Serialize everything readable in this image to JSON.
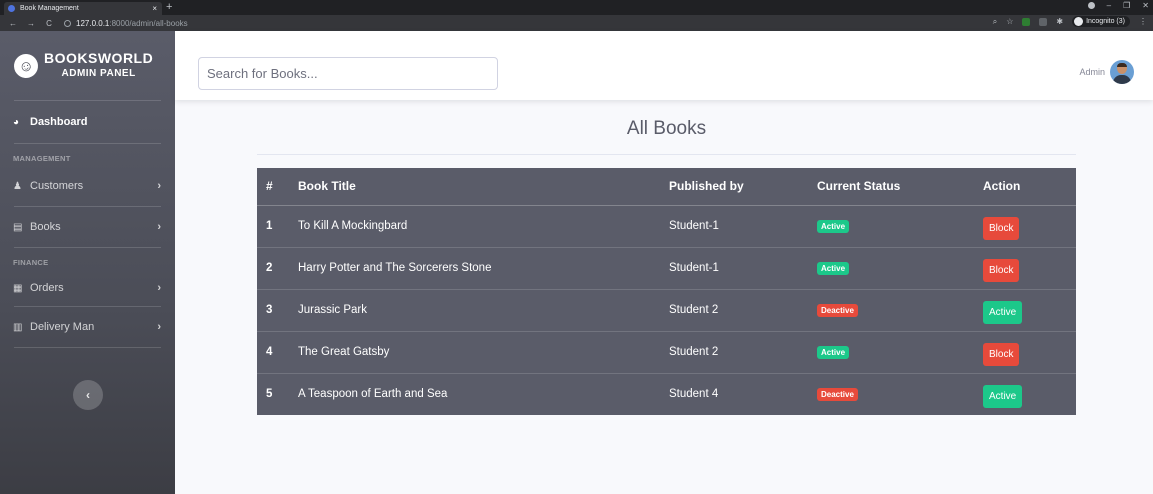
{
  "browser": {
    "tab_title": "Book Management",
    "tab_close": "×",
    "new_tab": "+",
    "url_host": "127.0.0.1",
    "url_path": ":8000/admin/all-books",
    "incognito_label": "Incognito (3)",
    "minimize": "–",
    "restore": "❐",
    "close": "✕"
  },
  "sidebar": {
    "brand_title": "BOOKSWORLD",
    "brand_subtitle": "ADMIN PANEL",
    "dashboard": "Dashboard",
    "heading_management": "MANAGEMENT",
    "heading_finance": "FINANCE",
    "items": [
      {
        "label": "Customers",
        "icon": "user-icon"
      },
      {
        "label": "Books",
        "icon": "book-icon"
      },
      {
        "label": "Orders",
        "icon": "table-icon"
      },
      {
        "label": "Delivery Man",
        "icon": "chart-icon"
      }
    ]
  },
  "topbar": {
    "search_placeholder": "Search for Books...",
    "user_name": "Admin"
  },
  "main": {
    "title": "All Books",
    "table": {
      "headers": [
        "#",
        "Book Title",
        "Published by",
        "Current Status",
        "Action"
      ],
      "rows": [
        {
          "num": "1",
          "title": "To Kill A Mockingbard",
          "publisher": "Student-1",
          "status": "Active",
          "action": "Block"
        },
        {
          "num": "2",
          "title": "Harry Potter and The Sorcerers Stone",
          "publisher": "Student-1",
          "status": "Active",
          "action": "Block"
        },
        {
          "num": "3",
          "title": "Jurassic Park",
          "publisher": "Student 2",
          "status": "Deactive",
          "action": "Active"
        },
        {
          "num": "4",
          "title": "The Great Gatsby",
          "publisher": "Student 2",
          "status": "Active",
          "action": "Block"
        },
        {
          "num": "5",
          "title": "A Teaspoon of Earth and Sea",
          "publisher": "Student 4",
          "status": "Deactive",
          "action": "Active"
        }
      ]
    }
  },
  "colors": {
    "sidebar": "#5a5c69",
    "success": "#1cc88a",
    "danger": "#e74a3b"
  }
}
